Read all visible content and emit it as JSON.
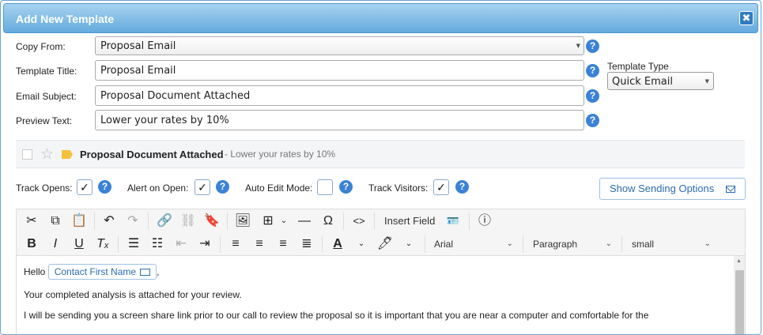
{
  "dialog": {
    "title": "Add New Template",
    "close_label": "✖"
  },
  "form": {
    "copy_from_label": "Copy From:",
    "copy_from_value": "Proposal Email",
    "template_title_label": "Template Title:",
    "template_title_value": "Proposal Email",
    "email_subject_label": "Email Subject:",
    "email_subject_value": "Proposal Document Attached",
    "preview_text_label": "Preview Text:",
    "preview_text_value": "Lower your rates by 10%",
    "help_glyph": "?",
    "template_type_label": "Template Type",
    "template_type_value": "Quick Email"
  },
  "preview": {
    "subject": "Proposal Document Attached",
    "preview_text": "- Lower your rates by 10%",
    "star_glyph": "☆"
  },
  "options": {
    "track_opens_label": "Track Opens:",
    "track_opens_checked": "✓",
    "alert_on_open_label": "Alert on Open:",
    "alert_on_open_checked": "✓",
    "auto_edit_mode_label": "Auto Edit Mode:",
    "auto_edit_mode_checked": "",
    "track_visitors_label": "Track Visitors:",
    "track_visitors_checked": "✓",
    "show_sending_options_label": "Show Sending Options"
  },
  "toolbar": {
    "insert_field_label": "Insert Field",
    "font_family": "Arial",
    "block_format": "Paragraph",
    "font_size": "small"
  },
  "content": {
    "greeting": "Hello",
    "merge_field": "Contact First Name",
    "greeting_end": ",",
    "line1": "Your completed analysis is attached for your review.",
    "line2": "I will be sending you a screen share link prior to our call to review the proposal so it is important that you are near a computer and comfortable for the"
  },
  "colors": {
    "title_bar": "#63aadd",
    "accent": "#3b82d6",
    "link": "#2b6cb0",
    "tag": "#f3c23c"
  }
}
